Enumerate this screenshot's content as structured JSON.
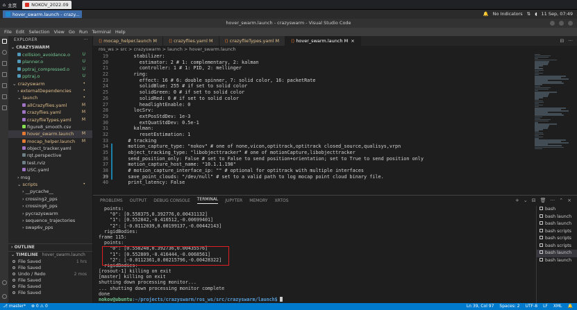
{
  "os": {
    "home_tab": "主页",
    "browser_tab": "NOKOV_2022.09",
    "indicators": "No Indicators",
    "clock": "11 Sep, 07:49"
  },
  "taskbar": {
    "active_window": "hover_swarm.launch - crazy..."
  },
  "window": {
    "title": "hover_swarm.launch - crazyswarm - Visual Studio Code"
  },
  "menu": [
    "File",
    "Edit",
    "Selection",
    "View",
    "Go",
    "Run",
    "Terminal",
    "Help"
  ],
  "sidebar": {
    "header": "EXPLORER",
    "workspace": "CRAZYSWARM",
    "items": [
      {
        "label": "collision_avoidance.o",
        "indent": 1,
        "kind": "file",
        "status": "U"
      },
      {
        "label": "planner.o",
        "indent": 1,
        "kind": "file",
        "status": "U"
      },
      {
        "label": "pptraj_compressed.o",
        "indent": 1,
        "kind": "file",
        "status": "U"
      },
      {
        "label": "pptraj.o",
        "indent": 1,
        "kind": "file",
        "status": "U"
      },
      {
        "label": "crazyswarm",
        "indent": 0,
        "kind": "folder-open",
        "status": "•"
      },
      {
        "label": "externalDependencies",
        "indent": 1,
        "kind": "folder",
        "status": "•"
      },
      {
        "label": "launch",
        "indent": 1,
        "kind": "folder-open",
        "status": "•"
      },
      {
        "label": "allCrazyflies.yaml",
        "indent": 2,
        "kind": "file",
        "status": "M"
      },
      {
        "label": "crazyflies.yaml",
        "indent": 2,
        "kind": "file",
        "status": "M"
      },
      {
        "label": "crazyflieTypes.yaml",
        "indent": 2,
        "kind": "file",
        "status": "M"
      },
      {
        "label": "figure8_smooth.csv",
        "indent": 2,
        "kind": "file",
        "status": ""
      },
      {
        "label": "hover_swarm.launch",
        "indent": 2,
        "kind": "file",
        "status": "M"
      },
      {
        "label": "mocap_helper.launch",
        "indent": 2,
        "kind": "file",
        "status": "M"
      },
      {
        "label": "object_tracker.yaml",
        "indent": 2,
        "kind": "file",
        "status": ""
      },
      {
        "label": "rqt.perspective",
        "indent": 2,
        "kind": "file",
        "status": ""
      },
      {
        "label": "test.rviz",
        "indent": 2,
        "kind": "file",
        "status": ""
      },
      {
        "label": "USC.yaml",
        "indent": 2,
        "kind": "file",
        "status": ""
      },
      {
        "label": "msg",
        "indent": 1,
        "kind": "folder",
        "status": ""
      },
      {
        "label": "scripts",
        "indent": 1,
        "kind": "folder-open",
        "status": "•"
      },
      {
        "label": "__pycache__",
        "indent": 2,
        "kind": "folder",
        "status": ""
      },
      {
        "label": "crossing2_pps",
        "indent": 2,
        "kind": "folder",
        "status": ""
      },
      {
        "label": "crossing6_pps",
        "indent": 2,
        "kind": "folder",
        "status": ""
      },
      {
        "label": "pycrazyswarm",
        "indent": 2,
        "kind": "folder",
        "status": ""
      },
      {
        "label": "sequence_trajectories",
        "indent": 2,
        "kind": "folder",
        "status": ""
      },
      {
        "label": "swap6v_pps",
        "indent": 2,
        "kind": "folder",
        "status": ""
      }
    ],
    "outline_label": "OUTLINE",
    "timeline_label": "TIMELINE",
    "timeline_file": "hover_swarm.launch",
    "timeline": [
      {
        "label": "File Saved",
        "time": "1 hrs"
      },
      {
        "label": "File Saved",
        "time": ""
      },
      {
        "label": "Undo / Redo",
        "time": "2 mos"
      },
      {
        "label": "File Saved",
        "time": ""
      },
      {
        "label": "File Saved",
        "time": ""
      },
      {
        "label": "File Saved",
        "time": ""
      }
    ]
  },
  "tabs": [
    {
      "label": "mocap_helper.launch  M",
      "active": false
    },
    {
      "label": "crazyflies.yaml  M",
      "active": false
    },
    {
      "label": "crazyflieTypes.yaml  M",
      "active": false
    },
    {
      "label": "hover_swarm.launch  M",
      "active": true
    }
  ],
  "breadcrumb": "ros_ws > src > crazyswarm > launch > hover_swarm.launch",
  "editor": {
    "lines": [
      {
        "n": "19",
        "t": "      stabilizer:"
      },
      {
        "n": "20",
        "t": "        estimator: 2 # 1: complementary, 2: kalman"
      },
      {
        "n": "21",
        "t": "        controller: 1 # 1: PID, 2: mellinger"
      },
      {
        "n": "22",
        "t": "      ring:"
      },
      {
        "n": "23",
        "t": "        effect: 16 # 6: double spinner, 7: solid color, 16: packetRate"
      },
      {
        "n": "24",
        "t": "        solidBlue: 255 # if set to solid color"
      },
      {
        "n": "25",
        "t": "        solidGreen: 0 # if set to solid color"
      },
      {
        "n": "26",
        "t": "        solidRed: 0 # if set to solid color"
      },
      {
        "n": "27",
        "t": "        headlightEnable: 0"
      },
      {
        "n": "28",
        "t": "      locSrv:"
      },
      {
        "n": "29",
        "t": "        extPosStdDev: 1e-3"
      },
      {
        "n": "30",
        "t": "        extQuatStdDev: 0.5e-1"
      },
      {
        "n": "31",
        "t": "      kalman:"
      },
      {
        "n": "32",
        "t": "        resetEstimation: 1"
      },
      {
        "n": "33",
        "t": "    # tracking"
      },
      {
        "n": "34",
        "t": "    motion_capture_type: \"nokov\" # one of none,vicon,optitrack,optitrack closed_source,qualisys,vrpn"
      },
      {
        "n": "35",
        "t": "    object_tracking_type: \"libobjecttracker\" # one of motionCapture,libobjecttracker"
      },
      {
        "n": "36",
        "t": "    send_position_only: False # set to False to send position+orientation; set to True to send position only"
      },
      {
        "n": "37",
        "t": "    motion_capture_host_name: \"10.1.1.198\""
      },
      {
        "n": "38",
        "t": "    # motion_capture_interface_ip: \"\" # optional for optitrack with multiple interfaces"
      },
      {
        "n": "39",
        "t": "    save_point_clouds: \"/dev/null\" # set to a valid path to log mocap point cloud binary file."
      },
      {
        "n": "40",
        "t": "    print_latency: False"
      }
    ]
  },
  "panel": {
    "tabs": [
      "PROBLEMS",
      "OUTPUT",
      "DEBUG CONSOLE",
      "TERMINAL",
      "JUPYTER",
      "MEMORY",
      "XRTOS"
    ],
    "problems_badge": "",
    "active_tab": "TERMINAL",
    "terminal_lines": [
      "  points:",
      "    \"0\": [0.558375,0.392776,0.00431132]",
      "    \"1\": [0.552842,-0.416512,-0.00699401]",
      "    \"2\": [-0.0112039,0.00199137,-0.00442143]",
      "  rigidBodies:",
      "frame 115:",
      "  points:",
      "    \"0\": [0.558248,0.392736,0.00435576]",
      "    \"1\": [0.552809,-0.416444,-0.0068561]",
      "    \"2\": [-0.0112361,0.00215796,-0.00428322]",
      "  rigidBodies:",
      "[rosout-1] killing on exit",
      "[master] killing on exit",
      "shutting down processing monitor...",
      "... shutting down processing monitor complete",
      "done"
    ],
    "prompt_user": "nokov@ubuntu",
    "prompt_path": ":~/projects/crazyswarm/ros_ws/src/crazyswarm/launch$",
    "terminals": [
      "bash",
      "bash launch",
      "bash launch",
      "bash scripts",
      "bash scripts",
      "bash scripts",
      "bash launch",
      "bash launch"
    ]
  },
  "status": {
    "branch": "master*",
    "sync": "⊗ 0 ⚠ 0",
    "position": "Ln 39, Col 97",
    "spaces": "Spaces: 2",
    "encoding": "UTF-8",
    "eol": "LF",
    "language": "XML"
  }
}
